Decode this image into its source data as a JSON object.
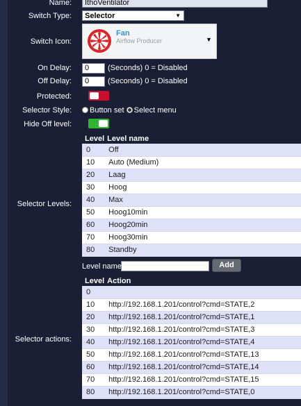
{
  "name": {
    "label": "Name:",
    "value": "IthoVentilator"
  },
  "switch_type": {
    "label": "Switch Type:",
    "value": "Selector"
  },
  "switch_icon": {
    "label": "Switch Icon:",
    "title": "Fan",
    "subtitle": "Airflow Producer",
    "icon": "fan-icon"
  },
  "on_delay": {
    "label": "On Delay:",
    "value": "0",
    "hint": "(Seconds) 0 = Disabled"
  },
  "off_delay": {
    "label": "Off Delay:",
    "value": "0",
    "hint": "(Seconds) 0 = Disabled"
  },
  "protected": {
    "label": "Protected:",
    "state": "off",
    "color": "#c8102e"
  },
  "selector_style": {
    "label": "Selector Style:",
    "option1": "Button set",
    "option2": "Select menu",
    "selected": "Select menu"
  },
  "hide_off": {
    "label": "Hide Off level:",
    "state": "on",
    "color": "#2fb52f"
  },
  "levels": {
    "label": "Selector Levels:",
    "col_level": "Level",
    "col_name": "Level name",
    "rows": [
      {
        "level": "0",
        "name": "Off"
      },
      {
        "level": "10",
        "name": "Auto (Medium)"
      },
      {
        "level": "20",
        "name": "Laag"
      },
      {
        "level": "30",
        "name": "Hoog"
      },
      {
        "level": "40",
        "name": "Max"
      },
      {
        "level": "50",
        "name": "Hoog10min"
      },
      {
        "level": "60",
        "name": "Hoog20min"
      },
      {
        "level": "70",
        "name": "Hoog30min"
      },
      {
        "level": "80",
        "name": "Standby"
      }
    ]
  },
  "add_level": {
    "label": "Level name:",
    "value": "",
    "button": "Add"
  },
  "actions": {
    "label": "Selector actions:",
    "col_level": "Level",
    "col_action": "Action",
    "rows": [
      {
        "level": "0",
        "action": ""
      },
      {
        "level": "10",
        "action": "http://192.168.1.201/control?cmd=STATE,2"
      },
      {
        "level": "20",
        "action": "http://192.168.1.201/control?cmd=STATE,1"
      },
      {
        "level": "30",
        "action": "http://192.168.1.201/control?cmd=STATE,3"
      },
      {
        "level": "40",
        "action": "http://192.168.1.201/control?cmd=STATE,4"
      },
      {
        "level": "50",
        "action": "http://192.168.1.201/control?cmd=STATE,13"
      },
      {
        "level": "60",
        "action": "http://192.168.1.201/control?cmd=STATE,14"
      },
      {
        "level": "70",
        "action": "http://192.168.1.201/control?cmd=STATE,15"
      },
      {
        "level": "80",
        "action": "http://192.168.1.201/control?cmd=STATE,0"
      }
    ]
  }
}
